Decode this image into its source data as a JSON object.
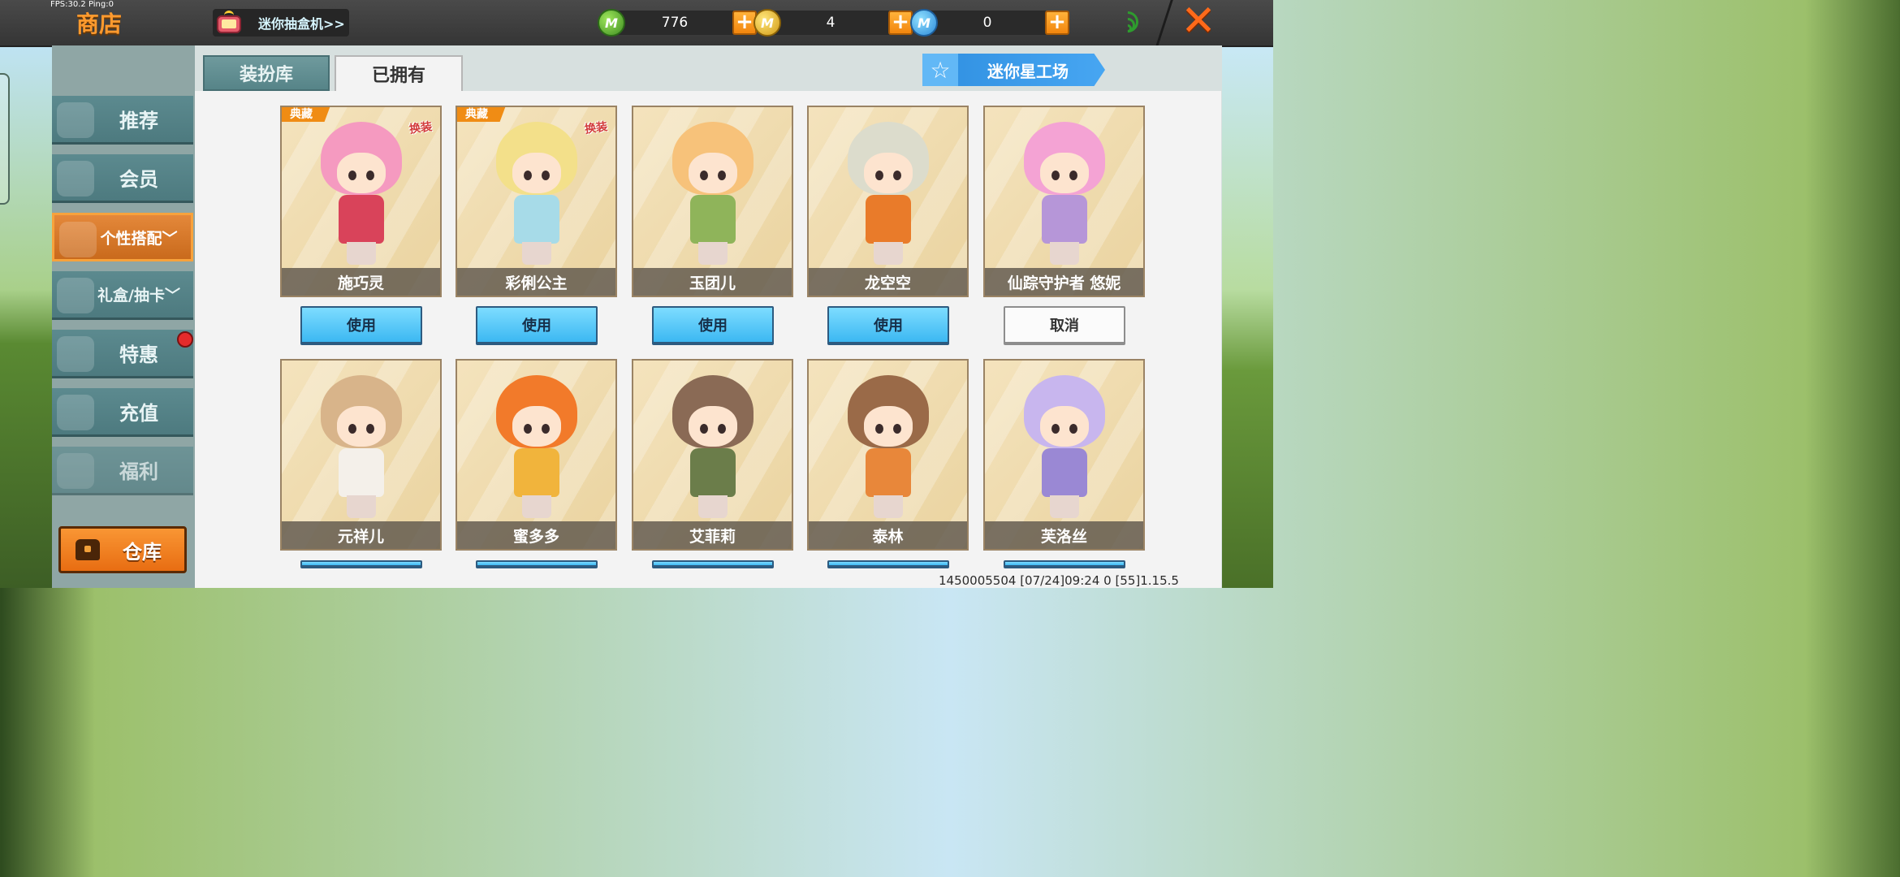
{
  "debug": {
    "fps_text": "FPS:30.2  Ping:0"
  },
  "header": {
    "title": "商店",
    "gacha_label": "迷你抽盒机>>",
    "currencies": [
      {
        "name": "mini-bean",
        "icon": "green-coin-icon",
        "value": "776",
        "color": "#4fa52a"
      },
      {
        "name": "mini-coin",
        "icon": "gold-coin-icon",
        "value": "4",
        "color": "#e0b126"
      },
      {
        "name": "mini-point",
        "icon": "blue-coin-icon",
        "value": "0",
        "color": "#3a9ce4"
      }
    ],
    "plus_symbol": "+",
    "close_symbol": "✕"
  },
  "sidebar": {
    "items": [
      {
        "label": "推荐",
        "icon": "thumbs-up-icon"
      },
      {
        "label": "会员",
        "icon": "vip-icon"
      },
      {
        "label": "个性搭配",
        "icon": "trophy-icon",
        "active": true,
        "chevron": "﹀"
      },
      {
        "label": "礼盒/抽卡",
        "icon": "disc-icon",
        "chevron": "﹀"
      },
      {
        "label": "特惠",
        "icon": "gift-box-icon"
      },
      {
        "label": "充值",
        "icon": "coin-stack-icon"
      },
      {
        "label": "福利",
        "icon": "present-icon"
      }
    ],
    "warehouse_label": "仓库"
  },
  "tabs": [
    {
      "label": "装扮库",
      "active": false
    },
    {
      "label": "已拥有",
      "active": true
    }
  ],
  "workshop_label": "迷你星工场",
  "tag_label": "典藏",
  "swap_label": "换装",
  "cards_row1": [
    {
      "name": "施巧灵",
      "tag": true,
      "swap": true,
      "action": "使用",
      "hair": "#f59ac0",
      "outfit": "#d9435a"
    },
    {
      "name": "彩俐公主",
      "tag": true,
      "swap": true,
      "action": "使用",
      "hair": "#f3e08a",
      "outfit": "#a7dbe8"
    },
    {
      "name": "玉团儿",
      "tag": false,
      "swap": false,
      "action": "使用",
      "hair": "#f7c27a",
      "outfit": "#8fb45a"
    },
    {
      "name": "龙空空",
      "tag": false,
      "swap": false,
      "action": "使用",
      "hair": "#dcdccc",
      "outfit": "#e97b2a"
    },
    {
      "name": "仙踪守护者 悠妮",
      "tag": false,
      "swap": false,
      "action": "取消",
      "hair": "#f4a3d4",
      "outfit": "#b696d8"
    }
  ],
  "cards_row2": [
    {
      "name": "元祥儿",
      "hair": "#d8b48a",
      "outfit": "#f4f0ea"
    },
    {
      "name": "蜜多多",
      "hair": "#f27a2a",
      "outfit": "#f1b43c"
    },
    {
      "name": "艾菲莉",
      "hair": "#8a6a55",
      "outfit": "#6b7d4a"
    },
    {
      "name": "泰林",
      "hair": "#9a6a48",
      "outfit": "#e8873a"
    },
    {
      "name": "芙洛丝",
      "hair": "#c8b6ee",
      "outfit": "#9a88d4"
    }
  ],
  "footer": {
    "info": "1450005504   [07/24]09:24 0 [55]1.15.5"
  }
}
